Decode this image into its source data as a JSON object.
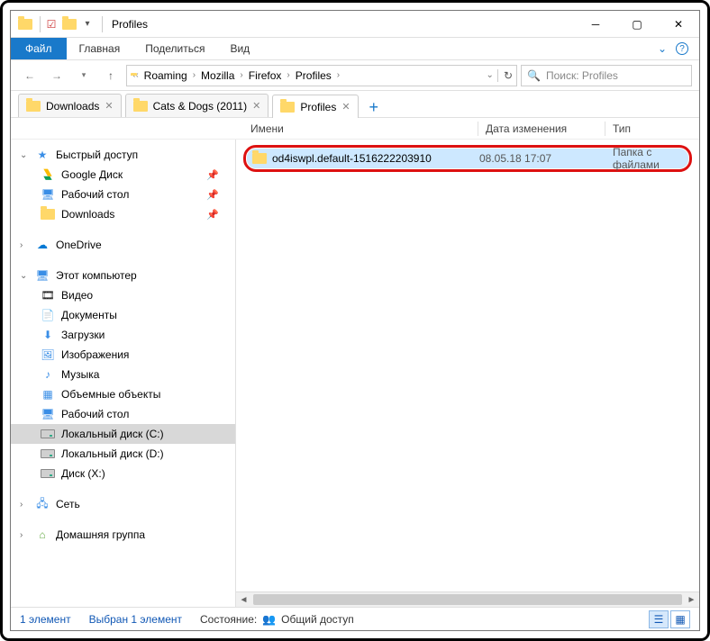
{
  "title": "Profiles",
  "menubar": {
    "file": "Файл",
    "home": "Главная",
    "share": "Поделиться",
    "view": "Вид"
  },
  "breadcrumbs": [
    "Roaming",
    "Mozilla",
    "Firefox",
    "Profiles"
  ],
  "search_placeholder": "Поиск: Profiles",
  "tabs": [
    {
      "label": "Downloads",
      "active": false
    },
    {
      "label": "Cats & Dogs (2011)",
      "active": false
    },
    {
      "label": "Profiles",
      "active": true
    }
  ],
  "columns": {
    "name": "Имени",
    "date": "Дата изменения",
    "type": "Тип"
  },
  "sidebar": {
    "quick": {
      "label": "Быстрый доступ",
      "items": [
        {
          "label": "Google Диск",
          "pin": true,
          "icon": "gdrive"
        },
        {
          "label": "Рабочий стол",
          "pin": true,
          "icon": "desktop"
        },
        {
          "label": "Downloads",
          "pin": true,
          "icon": "folder"
        }
      ]
    },
    "onedrive": "OneDrive",
    "thispc": {
      "label": "Этот компьютер",
      "items": [
        {
          "label": "Видео",
          "icon": "video"
        },
        {
          "label": "Документы",
          "icon": "docs"
        },
        {
          "label": "Загрузки",
          "icon": "downloads"
        },
        {
          "label": "Изображения",
          "icon": "pictures"
        },
        {
          "label": "Музыка",
          "icon": "music"
        },
        {
          "label": "Объемные объекты",
          "icon": "3d"
        },
        {
          "label": "Рабочий стол",
          "icon": "desktop"
        },
        {
          "label": "Локальный диск (C:)",
          "icon": "drive",
          "selected": true
        },
        {
          "label": "Локальный диск (D:)",
          "icon": "drive"
        },
        {
          "label": "Диск (X:)",
          "icon": "drive"
        }
      ]
    },
    "network": "Сеть",
    "homegroup": "Домашняя группа"
  },
  "row": {
    "name": "od4iswpl.default-1516222203910",
    "date": "08.05.18 17:07",
    "type": "Папка с файлами"
  },
  "status": {
    "count": "1 элемент",
    "selected": "Выбран 1 элемент",
    "state_label": "Состояние:",
    "state_value": "Общий доступ"
  }
}
